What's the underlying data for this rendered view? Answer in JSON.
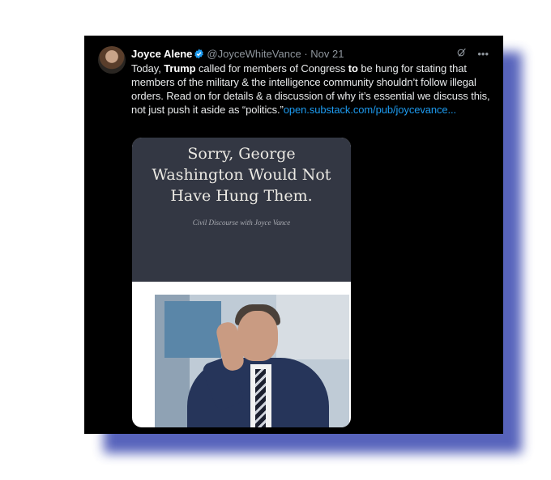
{
  "tweet": {
    "author_name": "Joyce Alene",
    "handle": "@JoyceWhiteVance",
    "separator": "·",
    "date": "Nov 21",
    "text_1": "Today, ",
    "text_bold_1": "Trump",
    "text_2": " called for members of Congress ",
    "text_bold_2": "to",
    "text_3": " be hung for stating that members of the military & the intelligence community shouldn’t follow illegal orders. Read on for details & a discussion of why it’s essential we discuss this, not just push it aside as “politics.”",
    "link_text": "open.substack.com/pub/joycevance...",
    "icons": [
      "avatar",
      "verified-badge-icon",
      "grok-icon",
      "more-icon"
    ]
  },
  "card": {
    "title": "Sorry, George\nWashington Would Not\nHave Hung Them.",
    "subtitle": "Civil Discourse with Joyce Vance"
  },
  "colors": {
    "background": "#000000",
    "link": "#1d9bf0",
    "muted": "#8f969d",
    "card_header": "#333743",
    "shadow": "#3a48b0"
  }
}
